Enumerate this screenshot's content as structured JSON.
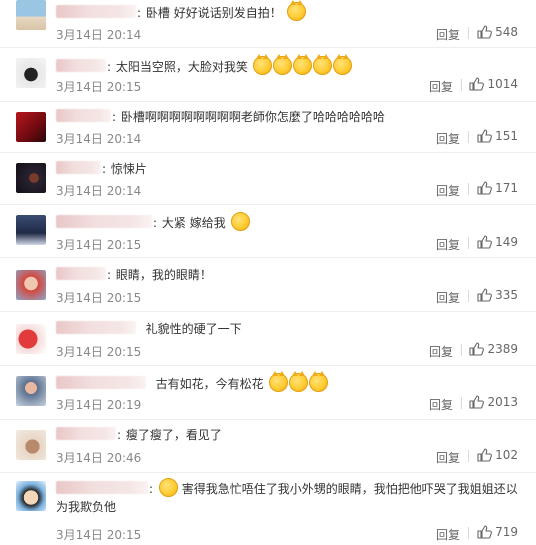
{
  "reply_label": "回复",
  "comments": [
    {
      "text": "卧槽 好好说话别发自拍！",
      "emojis": [
        "cat-grin-emoji"
      ],
      "time": "3月14日 20:14",
      "likes": "548"
    },
    {
      "text": "太阳当空照，大脸对我笑",
      "emojis": [
        "cat-grin-emoji",
        "cat-grin-emoji",
        "cat-grin-emoji",
        "cat-grin-emoji",
        "cat-grin-emoji"
      ],
      "time": "3月14日 20:15",
      "likes": "1014"
    },
    {
      "text": "卧槽啊啊啊啊啊啊啊啊老師你怎麼了哈哈哈哈哈哈",
      "emojis": [],
      "time": "3月14日 20:14",
      "likes": "151"
    },
    {
      "text": "惊悚片",
      "emojis": [],
      "time": "3月14日 20:14",
      "likes": "171"
    },
    {
      "text": "大紧 嫁给我",
      "emojis": [
        "relieved-face-emoji"
      ],
      "time": "3月14日 20:15",
      "likes": "149"
    },
    {
      "text": "眼睛，我的眼睛！",
      "emojis": [],
      "time": "3月14日 20:15",
      "likes": "335"
    },
    {
      "text": "礼貌性的硬了一下",
      "emojis": [],
      "time": "3月14日 20:15",
      "likes": "2389"
    },
    {
      "text": "古有如花，今有松花",
      "emojis": [
        "cat-grin-emoji",
        "cat-grin-emoji",
        "cat-grin-emoji"
      ],
      "time": "3月14日 20:19",
      "likes": "2013"
    },
    {
      "text": "瘦了瘦了，看见了",
      "emojis": [],
      "time": "3月14日 20:46",
      "likes": "102"
    },
    {
      "text": "害得我急忙唔住了我小外甥的眼睛，我怕把他吓哭了我姐姐还以为我欺负他",
      "emojis": [
        "smirk-face-emoji"
      ],
      "time": "3月14日 20:15",
      "likes": "719"
    }
  ],
  "colors": {
    "text": "#333333",
    "meta": "#888888",
    "divider": "#eeeeee"
  }
}
